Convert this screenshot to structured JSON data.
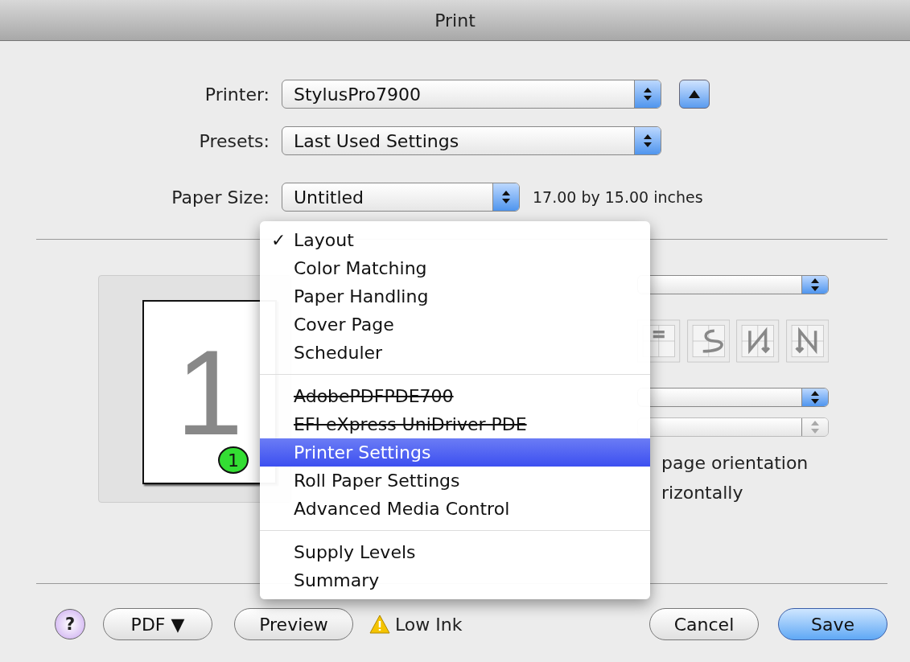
{
  "window": {
    "title": "Print"
  },
  "form": [
    {
      "kind": "printer",
      "label": "Printer:",
      "value": "StylusPro7900"
    },
    {
      "kind": "wide",
      "label": "Presets:",
      "value": "Last Used Settings"
    },
    {
      "kind": "paper",
      "label": "Paper Size:",
      "value": "Untitled",
      "note": "17.00 by 15.00 inches"
    }
  ],
  "pane_menu": {
    "check_mark": "✓",
    "groups": [
      [
        {
          "label": "Layout",
          "checked": true,
          "selected": false,
          "struck": false
        },
        {
          "label": "Color Matching",
          "checked": false,
          "selected": false,
          "struck": false
        },
        {
          "label": "Paper Handling",
          "checked": false,
          "selected": false,
          "struck": false
        },
        {
          "label": "Cover Page",
          "checked": false,
          "selected": false,
          "struck": false
        },
        {
          "label": "Scheduler",
          "checked": false,
          "selected": false,
          "struck": false
        }
      ],
      [
        {
          "label": "AdobePDFPDE700",
          "checked": false,
          "selected": false,
          "struck": true
        },
        {
          "label": "EFI eXpress UniDriver PDE",
          "checked": false,
          "selected": false,
          "struck": true
        },
        {
          "label": "Printer Settings",
          "checked": false,
          "selected": true,
          "struck": false
        },
        {
          "label": "Roll Paper Settings",
          "checked": false,
          "selected": false,
          "struck": false
        },
        {
          "label": "Advanced Media Control",
          "checked": false,
          "selected": false,
          "struck": false
        }
      ],
      [
        {
          "label": "Supply Levels",
          "checked": false,
          "selected": false,
          "struck": false
        },
        {
          "label": "Summary",
          "checked": false,
          "selected": false,
          "struck": false
        }
      ]
    ]
  },
  "preview": {
    "page_number": "1",
    "badge": "1"
  },
  "layout_options": {
    "popups": [
      {
        "disabled": false
      },
      {
        "disabled": false
      },
      {
        "disabled": true
      }
    ],
    "checkbox_labels": [
      "page orientation",
      "rizontally"
    ]
  },
  "footer": {
    "help": "?",
    "pdf": "PDF ▼",
    "preview": "Preview",
    "warning": "Low Ink",
    "cancel": "Cancel",
    "save": "Save"
  }
}
